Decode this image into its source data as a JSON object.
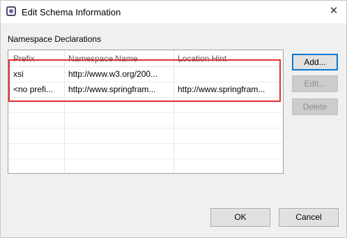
{
  "window": {
    "title": "Edit Schema Information",
    "close_icon": "close-icon"
  },
  "section": {
    "label": "Namespace Declarations"
  },
  "table": {
    "columns": [
      "Prefix",
      "Namespace Name",
      "Location Hint"
    ],
    "rows": [
      {
        "prefix": "xsi",
        "namespace": "http://www.w3.org/200...",
        "location": ""
      },
      {
        "prefix": "<no prefi...",
        "namespace": "http://www.springfram...",
        "location": "http://www.springfram..."
      }
    ]
  },
  "side_buttons": {
    "add": "Add...",
    "edit": "Edit...",
    "delete": "Delete"
  },
  "footer": {
    "ok": "OK",
    "cancel": "Cancel"
  },
  "colors": {
    "highlight": "#e03030",
    "focus_border": "#0078d7"
  }
}
